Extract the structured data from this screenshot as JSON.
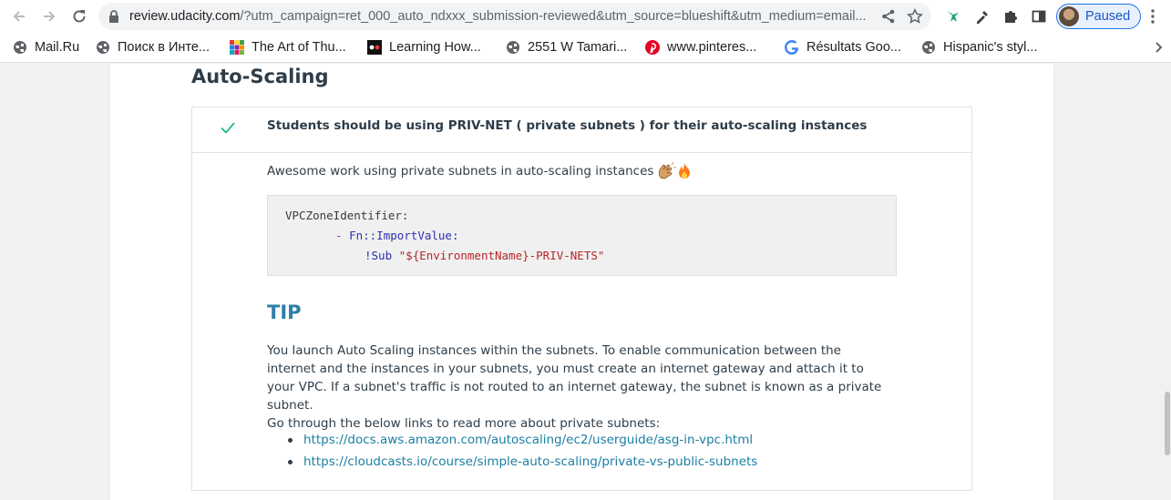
{
  "browser": {
    "url_host": "review.udacity.com",
    "url_rest": "/?utm_campaign=ret_000_auto_ndxxx_submission-reviewed&utm_source=blueshift&utm_medium=email...",
    "profile_label": "Paused"
  },
  "bookmarks": [
    {
      "label": "Mail.Ru",
      "icon": "globe-icon"
    },
    {
      "label": "Поиск в Инте...",
      "icon": "globe-icon"
    },
    {
      "label": "The Art of Thu...",
      "icon": "colorful-grid-icon"
    },
    {
      "label": "Learning How...",
      "icon": "cbc-icon"
    },
    {
      "label": "2551 W Tamari...",
      "icon": "globe-icon"
    },
    {
      "label": "www.pinteres...",
      "icon": "pinterest-icon"
    },
    {
      "label": "Résultats Goo...",
      "icon": "google-icon"
    },
    {
      "label": "Hispanic's styl...",
      "icon": "globe-icon"
    }
  ],
  "review": {
    "section_title": "Auto-Scaling",
    "spec_text": "Students should be using PRIV-NET ( private subnets ) for their auto-scaling instances",
    "status": "passed",
    "comment": "Awesome work using private subnets in auto-scaling instances",
    "code": {
      "line1_key": "VPCZoneIdentifier:",
      "line2_dash": "- ",
      "line2_fn": "Fn::ImportValue:",
      "line3_tag": "!Sub ",
      "line3_str": "\"${EnvironmentName}-PRIV-NETS\""
    },
    "tip_heading": "TIP",
    "tip_body": "You launch Auto Scaling instances within the subnets. To enable communication between the internet and the instances in your subnets, you must create an internet gateway and attach it to your VPC. If a subnet's traffic is not routed to an internet gateway, the subnet is known as a private subnet.",
    "tip_body2": "Go through the below links to read more about private subnets:",
    "links": [
      "https://docs.aws.amazon.com/autoscaling/ec2/userguide/asg-in-vpc.html",
      "https://cloudcasts.io/course/simple-auto-scaling/private-vs-public-subnets"
    ]
  },
  "colors": {
    "accent": "#1a73e8",
    "check": "#02b3e4",
    "link": "#1b7fa3",
    "tip": "#2f7fa8"
  }
}
